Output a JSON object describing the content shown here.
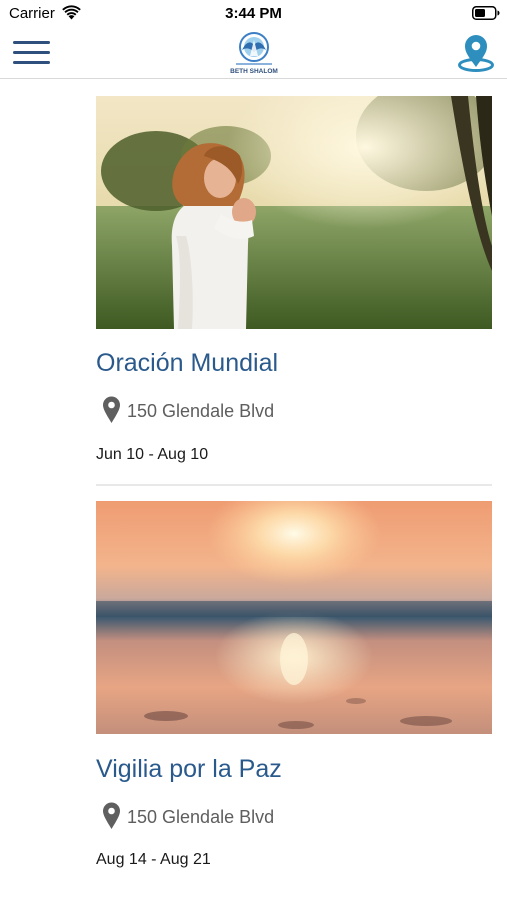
{
  "status_bar": {
    "carrier": "Carrier",
    "time": "3:44 PM"
  },
  "header": {
    "logo_text": "BETH SHALOM",
    "menu_icon": "hamburger-menu-icon",
    "location_icon": "map-pin-location-icon"
  },
  "events": [
    {
      "title": "Oración Mundial",
      "address": "150 Glendale Blvd",
      "dates": "Jun 10 - Aug 10",
      "image": "woman praying in park at sunset"
    },
    {
      "title": "Vigilia por la Paz",
      "address": "150 Glendale Blvd",
      "dates": "Aug 14 - Aug 21",
      "image": "blurred beach sunset"
    }
  ],
  "colors": {
    "accent": "#2a5a8c",
    "menu_icon": "#2f4f7d",
    "location_icon": "#2e8fbf",
    "address_text": "#5e5e5e"
  }
}
